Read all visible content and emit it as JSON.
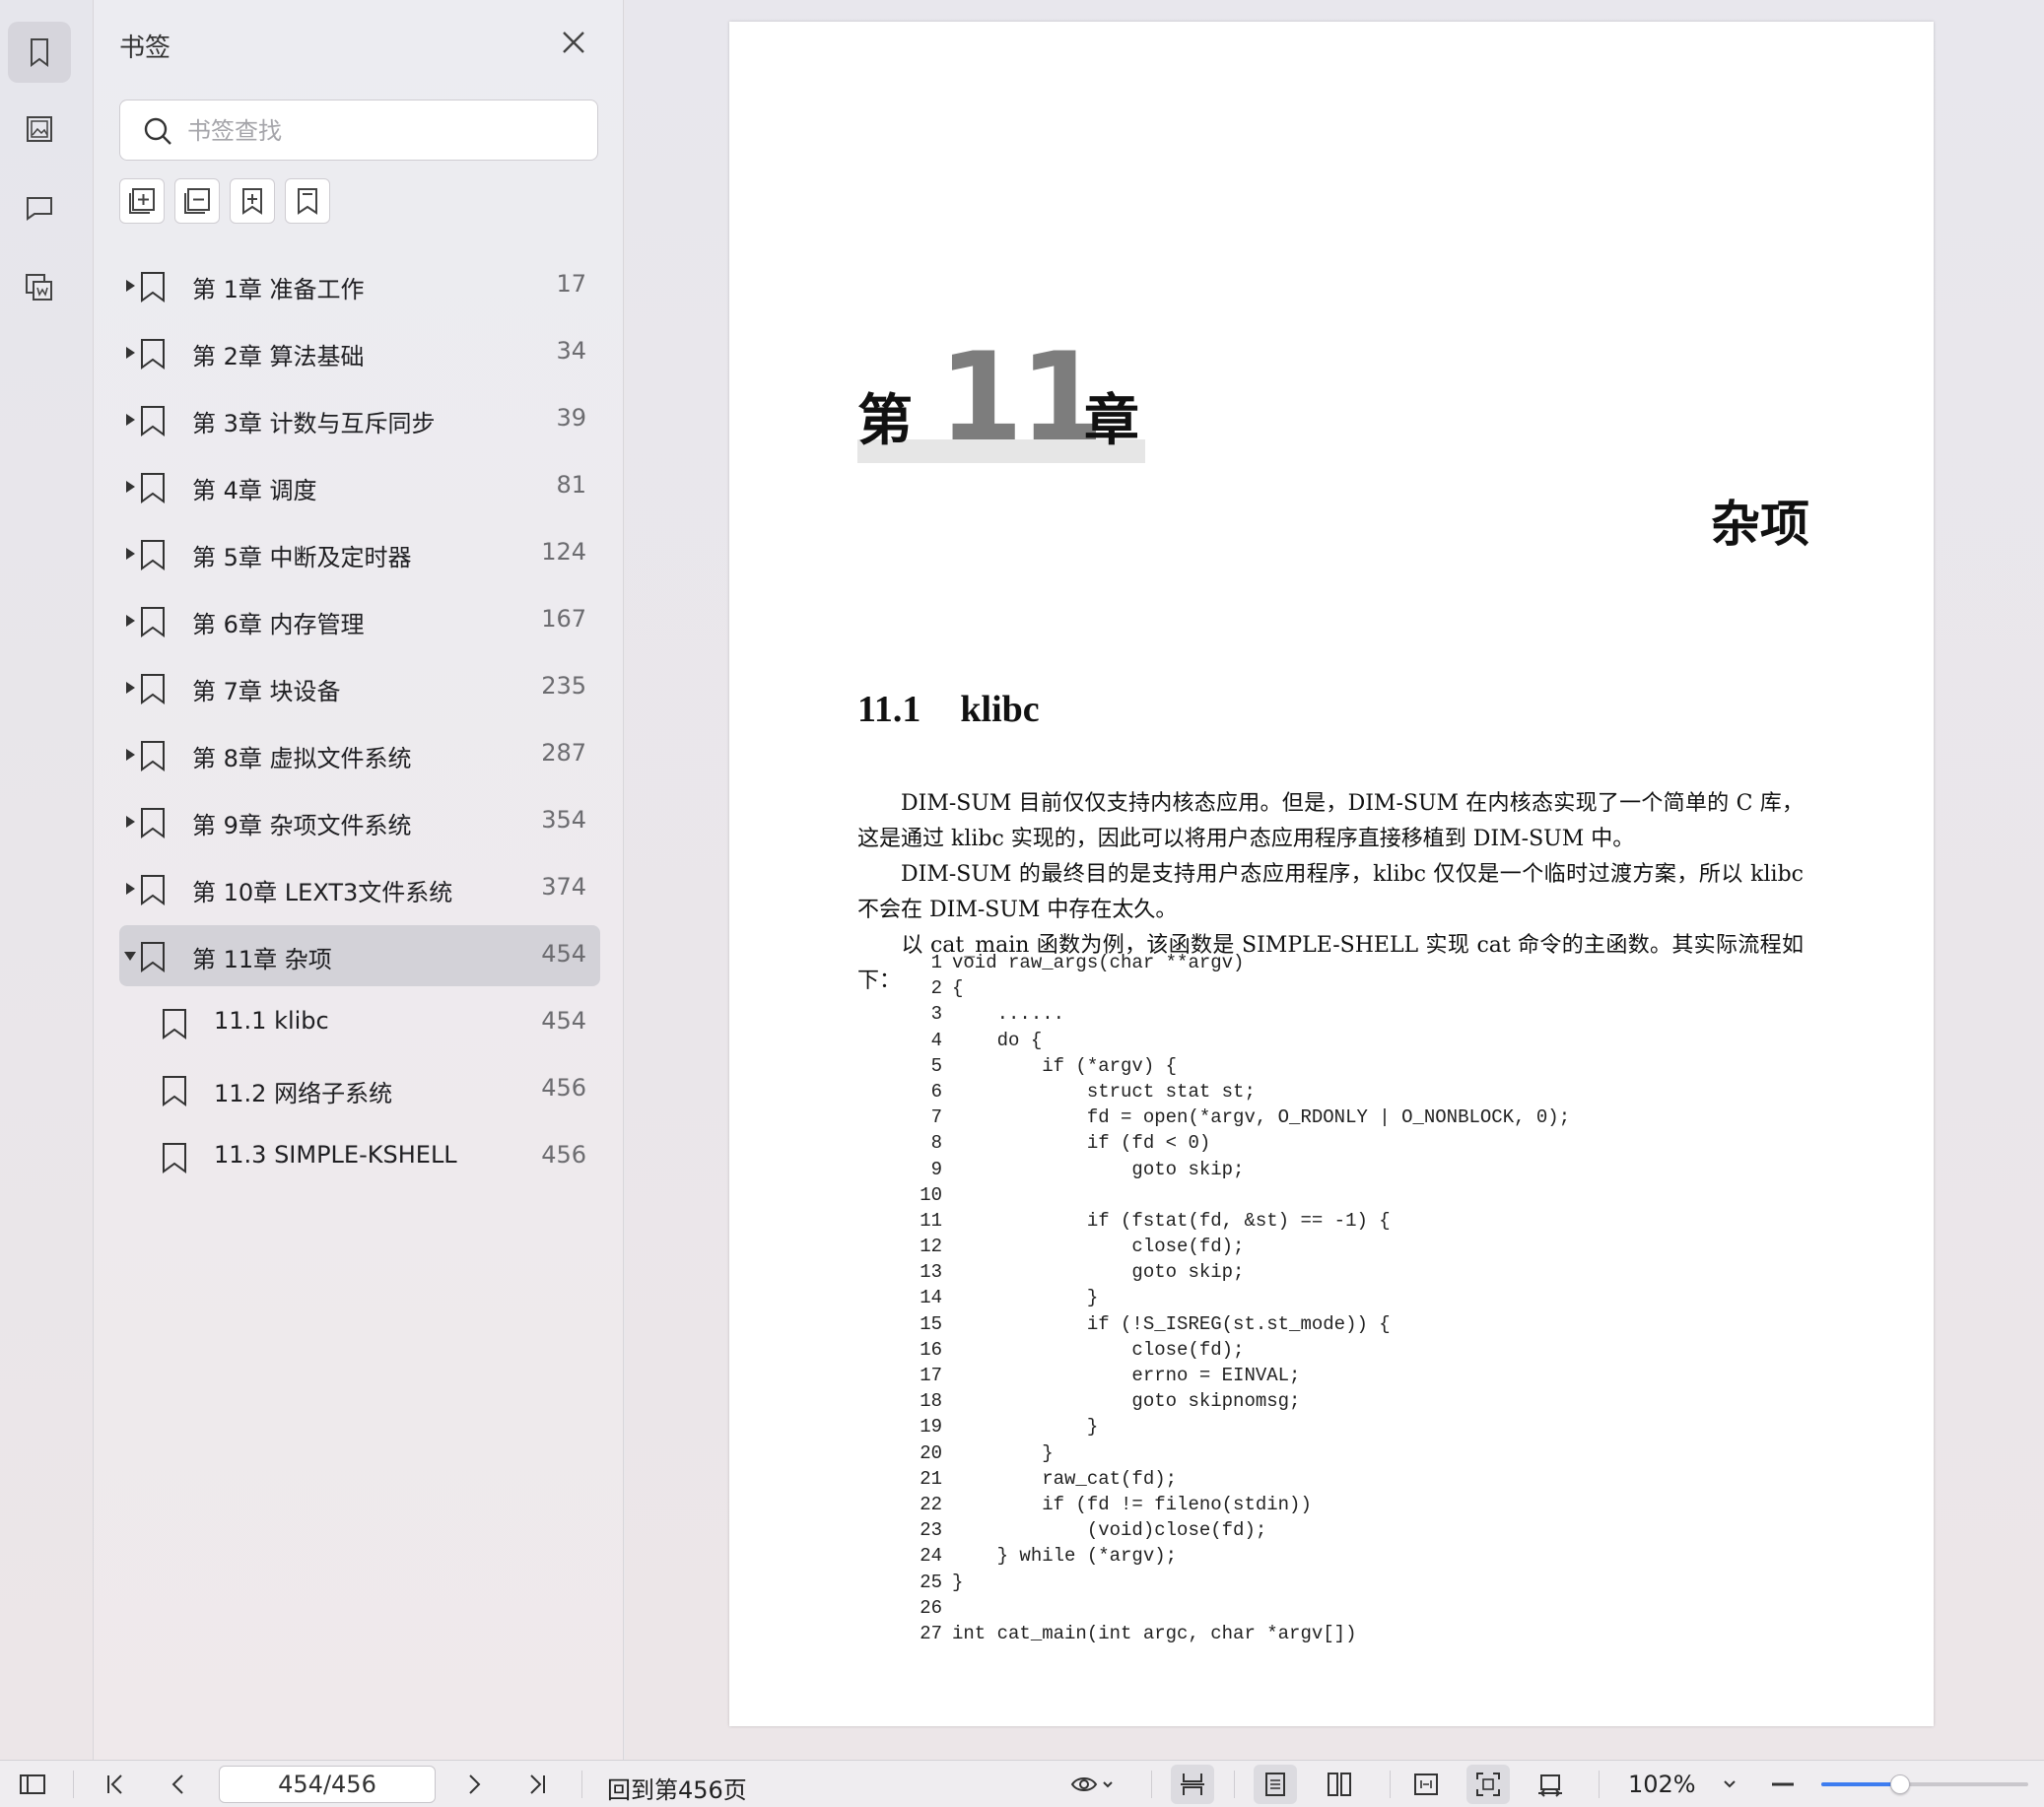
{
  "panel": {
    "title": "书签",
    "search_placeholder": "书签查找"
  },
  "bookmarks": [
    {
      "label": "第 1章 准备工作",
      "page": "17",
      "level": 0,
      "expanded": false
    },
    {
      "label": "第 2章 算法基础",
      "page": "34",
      "level": 0,
      "expanded": false
    },
    {
      "label": "第 3章 计数与互斥同步",
      "page": "39",
      "level": 0,
      "expanded": false
    },
    {
      "label": "第 4章 调度",
      "page": "81",
      "level": 0,
      "expanded": false
    },
    {
      "label": "第 5章 中断及定时器",
      "page": "124",
      "level": 0,
      "expanded": false
    },
    {
      "label": "第 6章 内存管理",
      "page": "167",
      "level": 0,
      "expanded": false
    },
    {
      "label": "第 7章 块设备",
      "page": "235",
      "level": 0,
      "expanded": false
    },
    {
      "label": "第 8章 虚拟文件系统",
      "page": "287",
      "level": 0,
      "expanded": false
    },
    {
      "label": "第 9章 杂项文件系统",
      "page": "354",
      "level": 0,
      "expanded": false
    },
    {
      "label": "第 10章 LEXT3文件系统",
      "page": "374",
      "level": 0,
      "expanded": false
    },
    {
      "label": "第 11章 杂项",
      "page": "454",
      "level": 0,
      "expanded": true,
      "selected": true
    },
    {
      "label": "11.1 klibc",
      "page": "454",
      "level": 1
    },
    {
      "label": "11.2 网络子系统",
      "page": "456",
      "level": 1
    },
    {
      "label": "11.3 SIMPLE-KSHELL",
      "page": "456",
      "level": 1
    }
  ],
  "document": {
    "chapter_prefix": "第",
    "chapter_number": "11",
    "chapter_suffix": "章",
    "chapter_title": "杂项",
    "section_number": "11.1",
    "section_title": "klibc",
    "paragraphs": [
      "DIM-SUM 目前仅仅支持内核态应用。但是，DIM-SUM 在内核态实现了一个简单的 C 库，这是通过 klibc 实现的，因此可以将用户态应用程序直接移植到 DIM-SUM 中。",
      "DIM-SUM 的最终目的是支持用户态应用程序，klibc 仅仅是一个临时过渡方案，所以 klibc 不会在 DIM-SUM 中存在太久。",
      "以 cat_main 函数为例，该函数是 SIMPLE-SHELL 实现 cat 命令的主函数。其实际流程如下："
    ],
    "code": [
      "void raw_args(char **argv)",
      "{",
      "    ......",
      "    do {",
      "        if (*argv) {",
      "            struct stat st;",
      "            fd = open(*argv, O_RDONLY | O_NONBLOCK, 0);",
      "            if (fd < 0)",
      "                goto skip;",
      "",
      "            if (fstat(fd, &st) == -1) {",
      "                close(fd);",
      "                goto skip;",
      "            }",
      "            if (!S_ISREG(st.st_mode)) {",
      "                close(fd);",
      "                errno = EINVAL;",
      "                goto skipnomsg;",
      "            }",
      "        }",
      "        raw_cat(fd);",
      "        if (fd != fileno(stdin))",
      "            (void)close(fd);",
      "    } while (*argv);",
      "}",
      "",
      "int cat_main(int argc, char *argv[])"
    ]
  },
  "toolbar": {
    "page_indicator": "454/456",
    "goto_label": "回到第456页",
    "zoom": "102%",
    "zoom_level": 0.38
  },
  "colors": {
    "accent": "#3d7cf0",
    "selected_row": "#d3d2d8"
  }
}
